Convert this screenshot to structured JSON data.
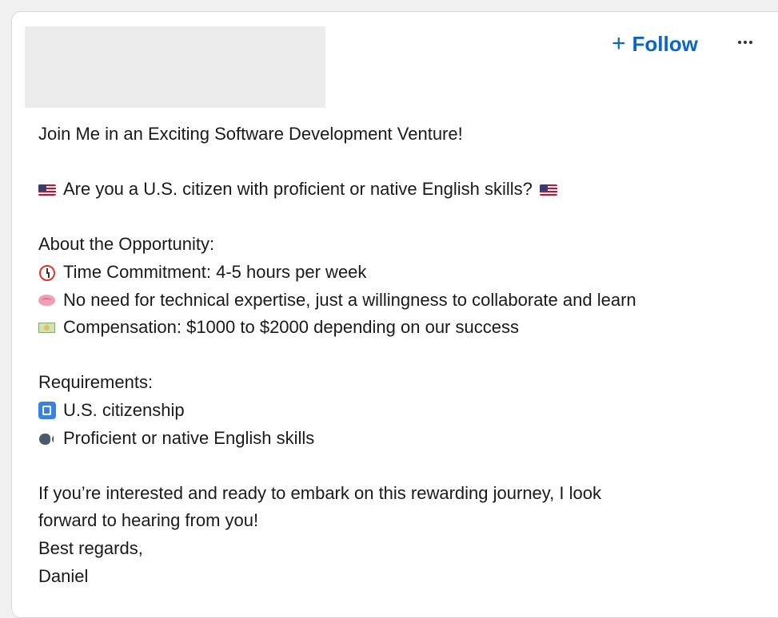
{
  "header": {
    "follow_label": "Follow",
    "follow_plus": "+"
  },
  "post": {
    "title": "Join Me in an Exciting Software Development Venture!",
    "question": "Are you a U.S. citizen with proficient or native English skills?",
    "about_heading": "About the Opportunity:",
    "about_items": [
      {
        "icon": "alarm-clock-icon",
        "text": "Time Commitment: 4-5 hours per week"
      },
      {
        "icon": "brain-icon",
        "text": "No need for technical expertise, just a willingness to collaborate and learn"
      },
      {
        "icon": "money-icon",
        "text": "Compensation: $1000 to $2000 depending on our success"
      }
    ],
    "requirements_heading": "Requirements:",
    "requirement_items": [
      {
        "icon": "passport-control-icon",
        "text": "U.S. citizenship"
      },
      {
        "icon": "speaking-head-icon",
        "text": "Proficient or native English skills"
      }
    ],
    "closing_line1": "If you’re interested and ready to embark on this rewarding journey, I look",
    "closing_line2": "forward to hearing from you!",
    "sign_off": "Best regards,",
    "signature": "Daniel"
  },
  "colors": {
    "follow": "#0a66c2",
    "text": "#1a1a1a",
    "redaction": "#ececec"
  }
}
